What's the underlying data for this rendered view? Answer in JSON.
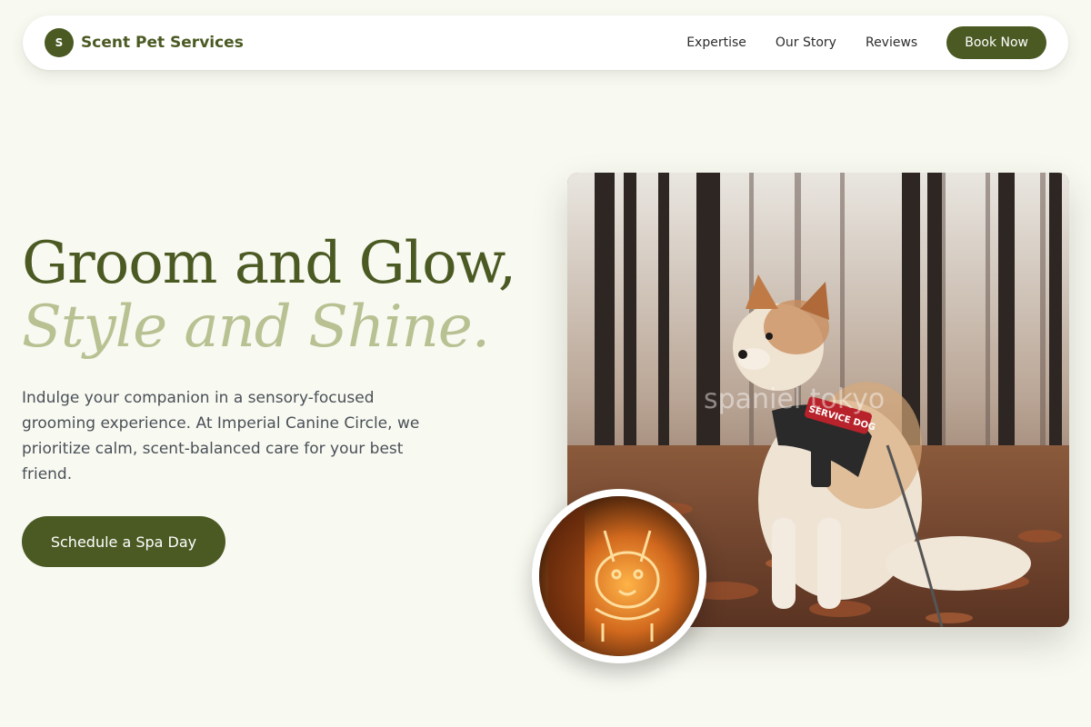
{
  "brand": {
    "initial": "S",
    "name": "Scent Pet Services"
  },
  "nav": {
    "links": [
      "Expertise",
      "Our Story",
      "Reviews"
    ],
    "cta_label": "Book Now"
  },
  "hero": {
    "title_line1": "Groom and Glow,",
    "title_line2": "Style and Shine.",
    "description": "Indulge your companion in a sensory-focused grooming experience. At Imperial Canine Circle, we prioritize calm, scent-balanced care for your best friend.",
    "cta_label": "Schedule a Spa Day"
  },
  "media": {
    "main_photo_watermark": "spaniel tokyo",
    "main_photo_subject": "service dog in autumn forest",
    "harness_text": "SERVICE DOG",
    "badge_subject": "neon dog head sign"
  },
  "colors": {
    "brand_green": "#4b5a23",
    "accent_sage": "#b7c192",
    "background": "#f8f9f1"
  }
}
